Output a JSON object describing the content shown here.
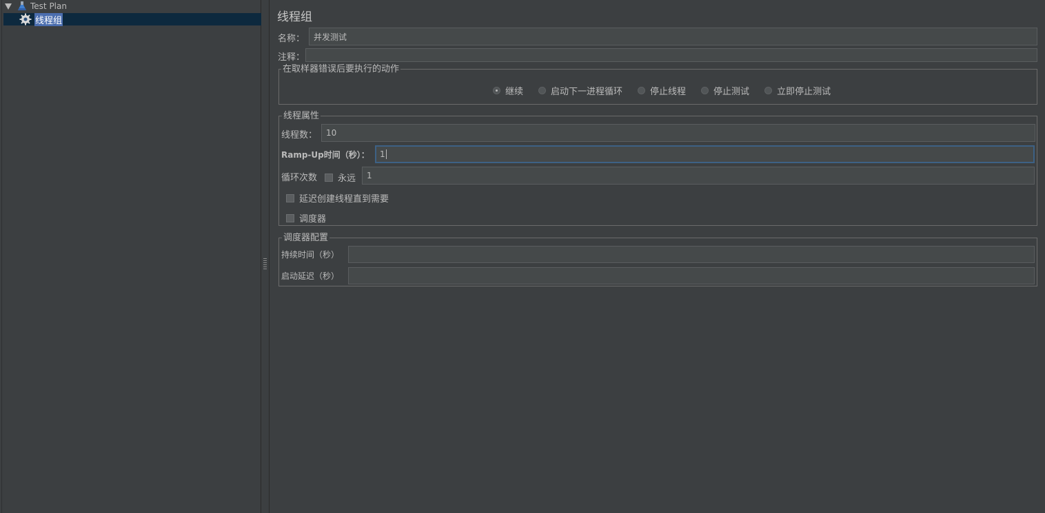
{
  "tree": {
    "root": {
      "label": "Test Plan",
      "expanded": true,
      "icon": "flask-icon"
    },
    "child": {
      "label": "线程组",
      "selected": true,
      "icon": "gear-icon"
    }
  },
  "panel": {
    "title": "线程组",
    "name_label": "名称：",
    "name_value": "并发测试",
    "comment_label": "注释：",
    "comment_value": "",
    "error_action": {
      "title": "在取样器错误后要执行的动作",
      "options": [
        "继续",
        "启动下一进程循环",
        "停止线程",
        "停止测试",
        "立即停止测试"
      ],
      "selected": "继续"
    },
    "thread_props": {
      "title": "线程属性",
      "threads_label": "线程数：",
      "threads_value": "10",
      "rampup_label": "Ramp-Up时间（秒）：",
      "rampup_value": "1",
      "loop_label": "循环次数",
      "forever_label": "永远",
      "forever_checked": false,
      "loop_value": "1",
      "delay_label": "延迟创建线程直到需要",
      "delay_checked": false,
      "scheduler_label": "调度器",
      "scheduler_checked": false
    },
    "scheduler_config": {
      "title": "调度器配置",
      "duration_label": "持续时间（秒）",
      "duration_value": "",
      "startup_delay_label": "启动延迟（秒）",
      "startup_delay_value": ""
    }
  },
  "colors": {
    "background": "#3c3f41",
    "field": "#45494a",
    "selection": "#0d293e",
    "highlight": "#4b6eaf",
    "text": "#bbbbbb",
    "focus_border": "#3d6185"
  }
}
